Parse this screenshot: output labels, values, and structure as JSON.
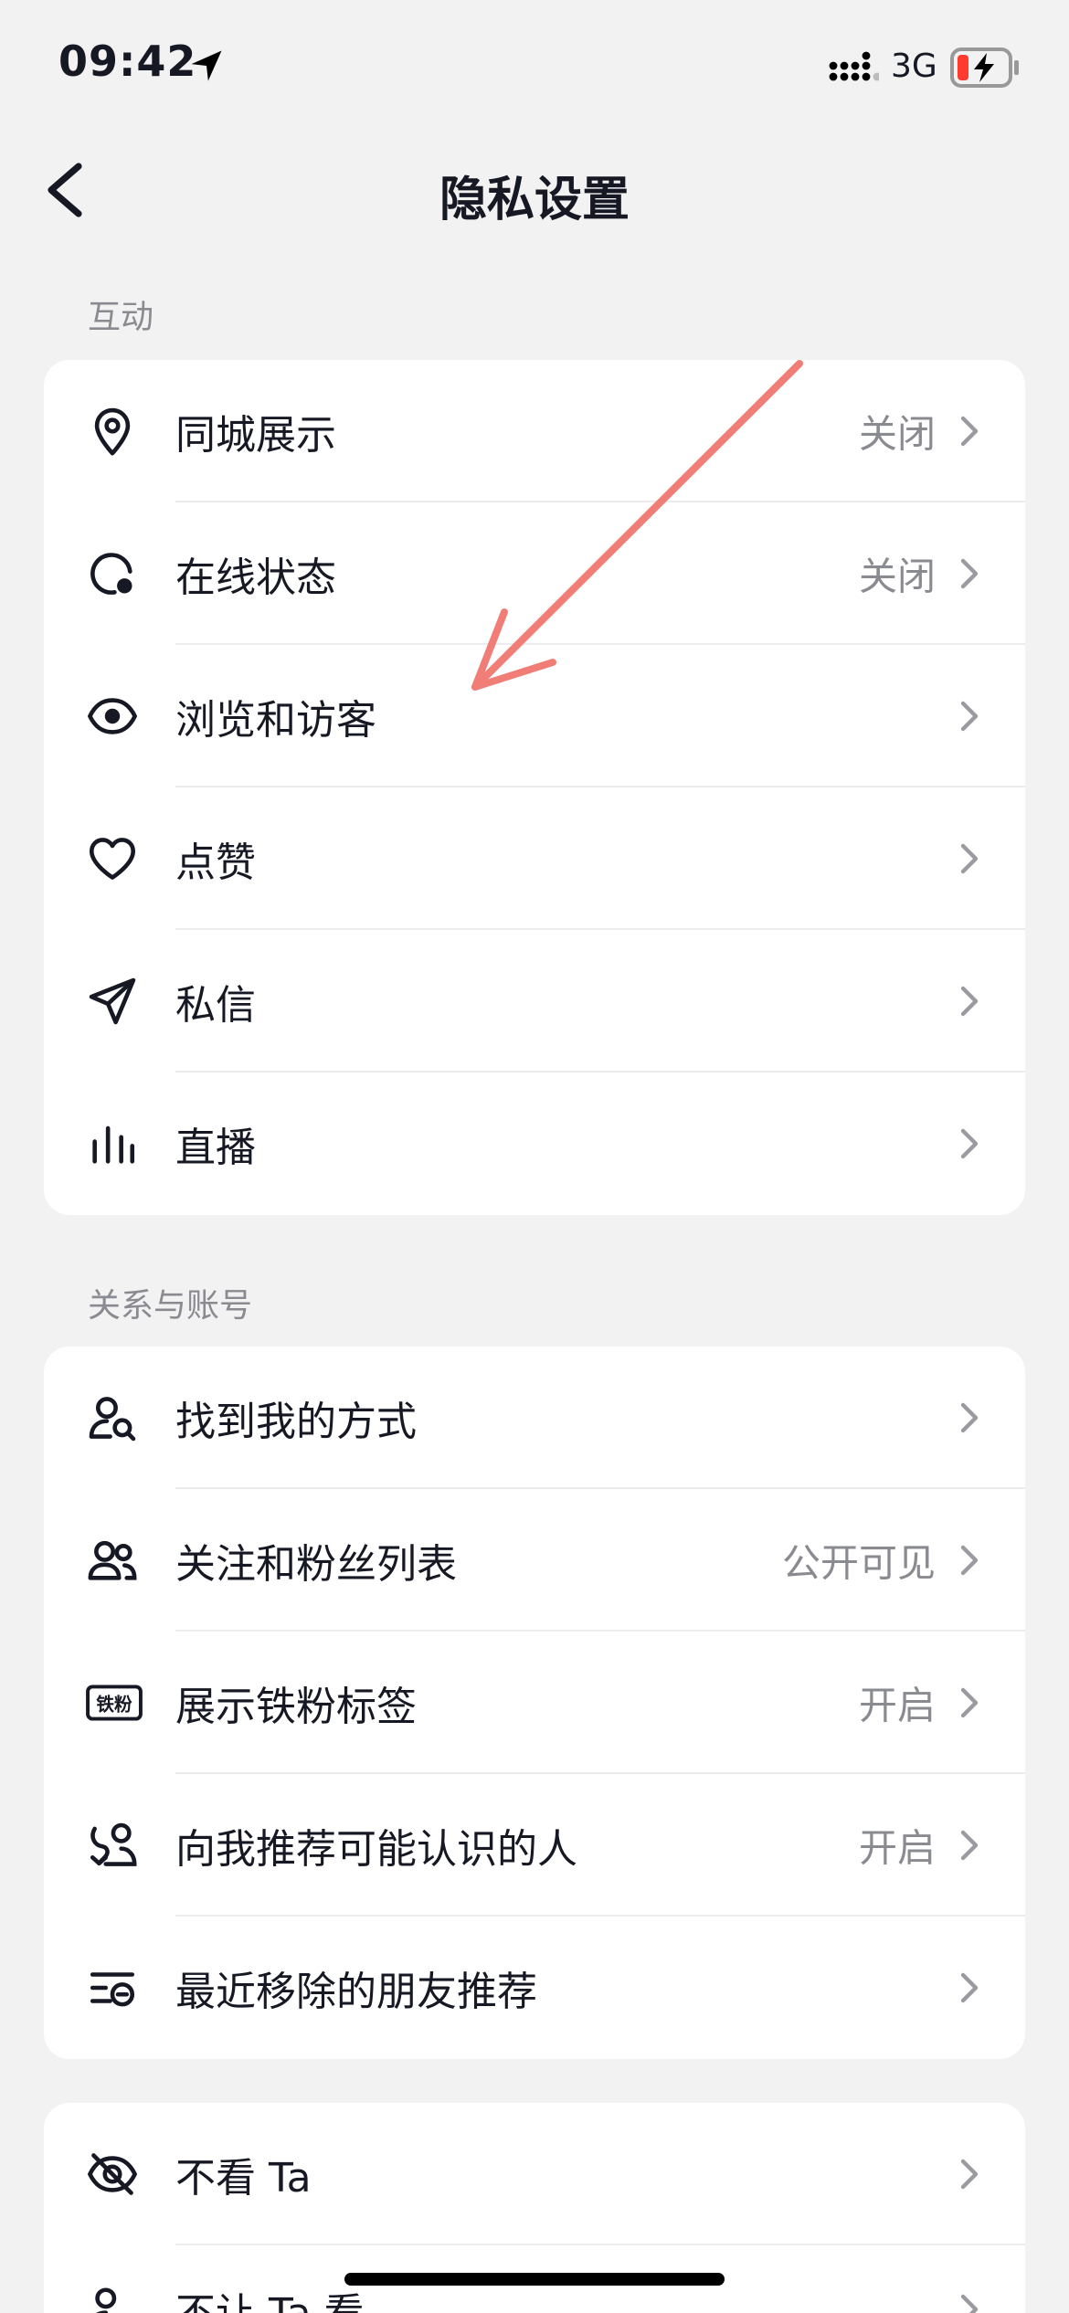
{
  "status_bar": {
    "time": "09:42",
    "network": "3G",
    "battery_color": "#ff3b30"
  },
  "nav": {
    "title": "隐私设置"
  },
  "sections": {
    "interaction": {
      "header": "互动",
      "items": [
        {
          "label": "同城展示",
          "value": "关闭",
          "icon": "location-pin-icon"
        },
        {
          "label": "在线状态",
          "value": "关闭",
          "icon": "online-status-icon"
        },
        {
          "label": "浏览和访客",
          "value": "",
          "icon": "eye-icon"
        },
        {
          "label": "点赞",
          "value": "",
          "icon": "heart-icon"
        },
        {
          "label": "私信",
          "value": "",
          "icon": "paper-plane-icon"
        },
        {
          "label": "直播",
          "value": "",
          "icon": "bars-icon"
        }
      ]
    },
    "relations": {
      "header": "关系与账号",
      "items": [
        {
          "label": "找到我的方式",
          "value": "",
          "icon": "user-search-icon"
        },
        {
          "label": "关注和粉丝列表",
          "value": "公开可见",
          "icon": "users-icon"
        },
        {
          "label": "展示铁粉标签",
          "value": "开启",
          "icon": "fan-badge-icon",
          "badge_text": "铁粉"
        },
        {
          "label": "向我推荐可能认识的人",
          "value": "开启",
          "icon": "recommend-user-icon"
        },
        {
          "label": "最近移除的朋友推荐",
          "value": "",
          "icon": "removed-list-icon"
        }
      ]
    },
    "hidden": {
      "items": [
        {
          "label": "不看 Ta",
          "value": "",
          "icon": "eye-off-icon"
        },
        {
          "label": "不让 Ta 看",
          "value": "",
          "icon": "user-block-icon"
        }
      ]
    }
  },
  "colors": {
    "accent_annotation": "#f07e76",
    "secondary_text": "#8a8b91",
    "background": "#f2f2f3"
  }
}
